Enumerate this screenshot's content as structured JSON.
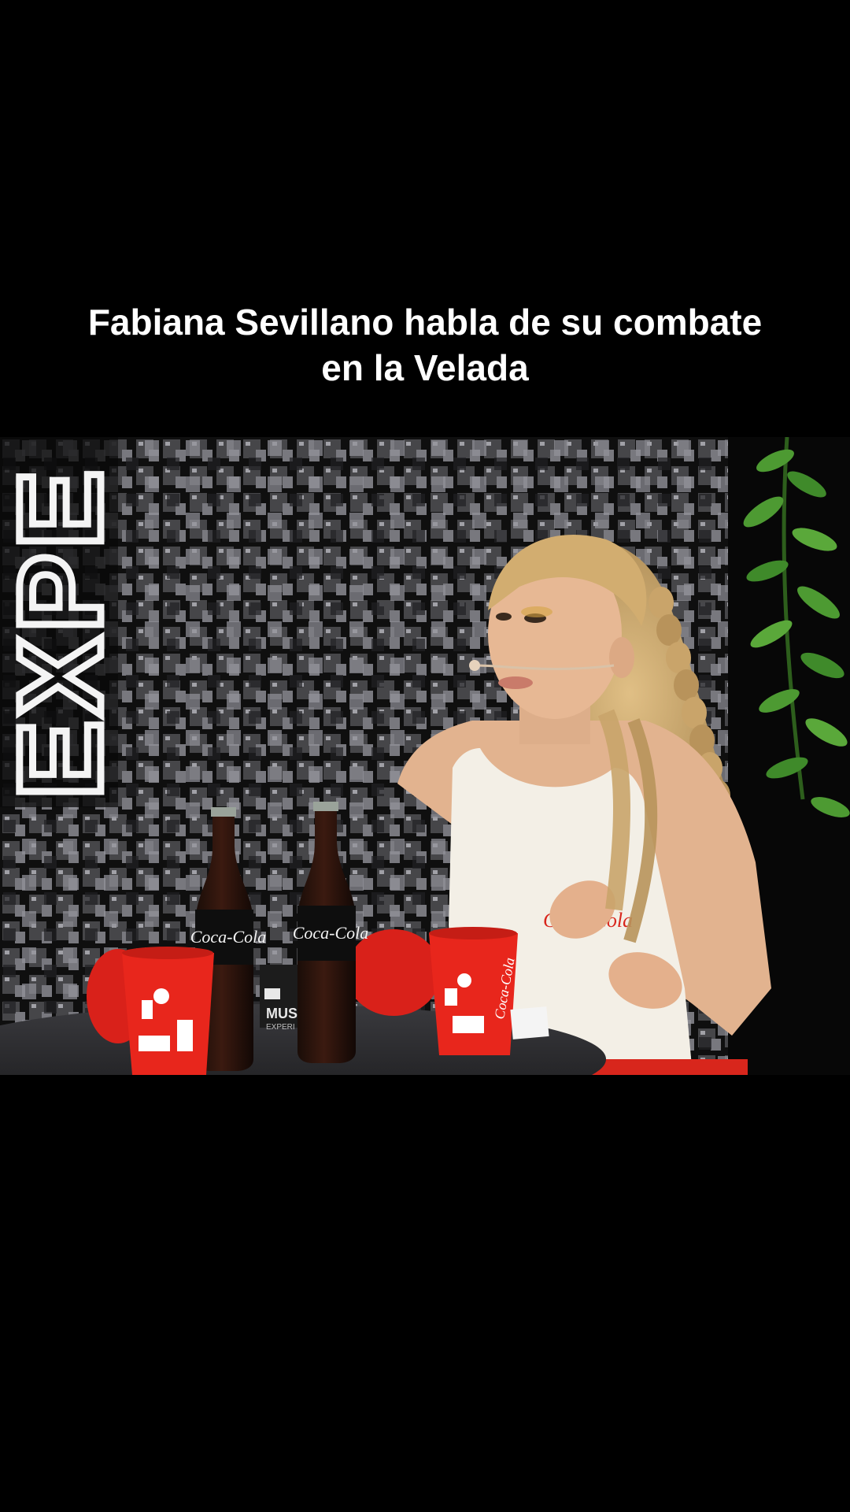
{
  "caption": {
    "line1": "Fabiana Sevillano habla de su combate",
    "line2": "en la Velada"
  },
  "video": {
    "neon_sign_text": "EXPE",
    "bottle_label": "Coca-Cola",
    "shirt_logo": "Coca-Cola",
    "mic_box_text": "MUS",
    "mic_box_subtext": "EXPERI",
    "cup_logo": "Coca-Cola"
  },
  "colors": {
    "background": "#000000",
    "caption_text": "#ffffff",
    "cup_red": "#e8261c",
    "shirt": "#f3efe6",
    "hair": "#c9a46a",
    "skin": "#e7b894",
    "plant": "#3f8a2a"
  }
}
